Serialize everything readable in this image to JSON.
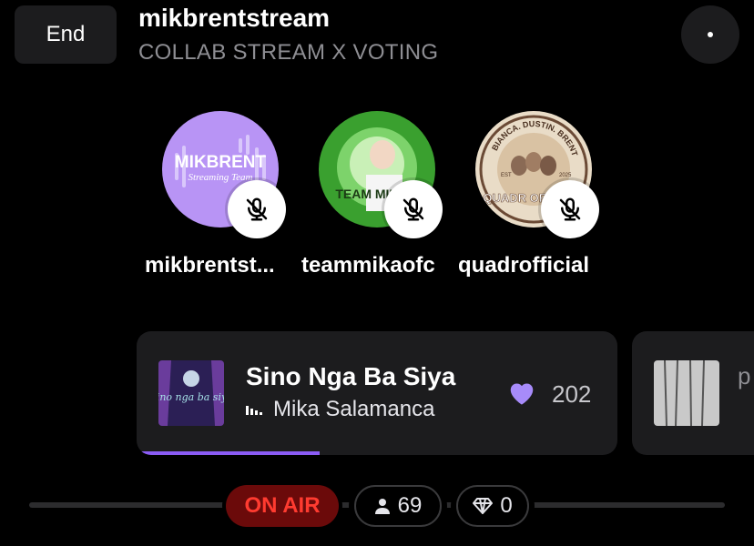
{
  "header": {
    "end_label": "End",
    "title": "mikbrentstream",
    "subtitle": "COLLAB STREAM X VOTING",
    "more_icon": "more-horizontal-icon"
  },
  "participants": [
    {
      "name": "mikbrentst...",
      "avatar_text": "MIKBRENT",
      "avatar_subtext": "Streaming Team",
      "muted": true,
      "avatar_color": "#b894f5"
    },
    {
      "name": "teammikaofc",
      "avatar_text": "TEAM MIKA",
      "muted": true,
      "avatar_color": "#3aa02f"
    },
    {
      "name": "quadrofficial",
      "avatar_text": "QUADR OFFICIAL",
      "avatar_ring_text": "BIANCA. DUSTIN. BRENT. MIKA",
      "avatar_badges": [
        "EST",
        "2025"
      ],
      "muted": true,
      "avatar_color": "#e9dcc7"
    }
  ],
  "now_playing": {
    "title": "Sino Nga Ba Siya",
    "artist": "Mika Salamanca",
    "likes": "202",
    "progress_percent": 38,
    "cover_text": "Sino nga ba siya",
    "heart_color": "#a78bfa"
  },
  "next_track": {
    "peek_text": "p"
  },
  "status": {
    "on_air_label": "ON AIR",
    "listeners": "69",
    "gems": "0"
  },
  "colors": {
    "accent": "#8b5cf6",
    "on_air_bg": "#6b0a0a",
    "on_air_text": "#ff3b30"
  }
}
